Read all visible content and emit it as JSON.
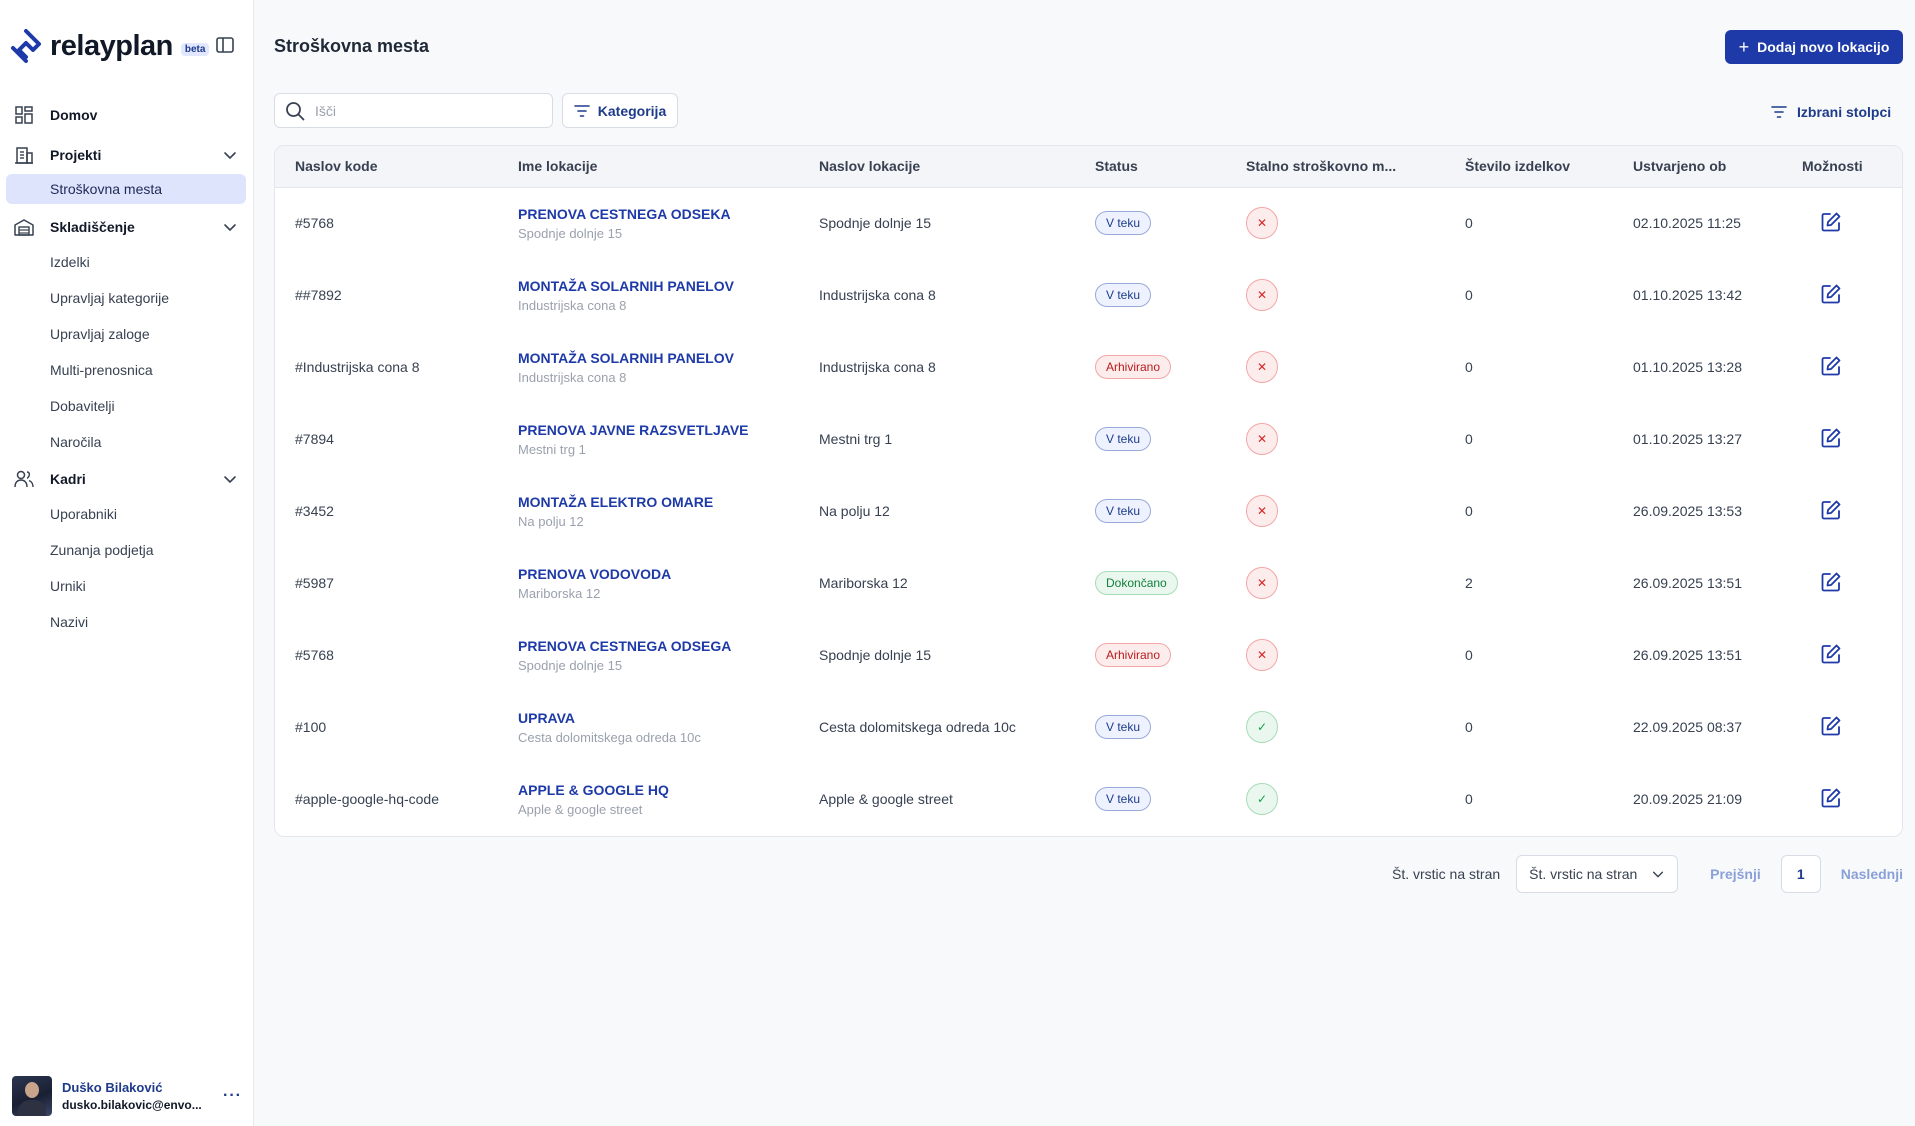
{
  "brand": {
    "name": "relayplan",
    "badge": "beta",
    "logo_icon": "relayplan-logo-icon"
  },
  "sidebar": {
    "groups": [
      {
        "label": "Domov",
        "icon": "dashboard-grid-icon",
        "expandable": false,
        "items": []
      },
      {
        "label": "Projekti",
        "icon": "building-icon",
        "expandable": true,
        "items": [
          {
            "label": "Stroškovna mesta",
            "active": true
          }
        ]
      },
      {
        "label": "Skladiščenje",
        "icon": "warehouse-icon",
        "expandable": true,
        "items": [
          {
            "label": "Izdelki"
          },
          {
            "label": "Upravljaj kategorije"
          },
          {
            "label": "Upravljaj zaloge"
          },
          {
            "label": "Multi-prenosnica"
          },
          {
            "label": "Dobavitelji"
          },
          {
            "label": "Naročila"
          }
        ]
      },
      {
        "label": "Kadri",
        "icon": "users-icon",
        "expandable": true,
        "items": [
          {
            "label": "Uporabniki"
          },
          {
            "label": "Zunanja podjetja"
          },
          {
            "label": "Urniki"
          },
          {
            "label": "Nazivi"
          }
        ]
      }
    ]
  },
  "user": {
    "name": "Duško Bilaković",
    "email": "dusko.bilakovic@envo..."
  },
  "header": {
    "title": "Stroškovna mesta",
    "add_button": "Dodaj novo lokacijo"
  },
  "toolbar": {
    "search_placeholder": "Išči",
    "category_button": "Kategorija",
    "columns_button": "Izbrani stolpci"
  },
  "table": {
    "columns": [
      "Naslov kode",
      "Ime lokacije",
      "Naslov lokacije",
      "Status",
      "Stalno stroškovno m...",
      "Število izdelkov",
      "Ustvarjeno ob",
      "Možnosti"
    ],
    "rows": [
      {
        "code": "#5768",
        "name": "PRENOVA CESTNEGA ODSEKA",
        "sub": "Spodnje dolnje 15",
        "address": "Spodnje dolnje 15",
        "status": "V teku",
        "status_color": "blue",
        "permanent": false,
        "count": "0",
        "created": "02.10.2025 11:25"
      },
      {
        "code": "##7892",
        "name": "MONTAŽA SOLARNIH PANELOV",
        "sub": "Industrijska cona 8",
        "address": "Industrijska cona 8",
        "status": "V teku",
        "status_color": "blue",
        "permanent": false,
        "count": "0",
        "created": "01.10.2025 13:42"
      },
      {
        "code": "#Industrijska cona 8",
        "name": "MONTAŽA SOLARNIH PANELOV",
        "sub": "Industrijska cona 8",
        "address": "Industrijska cona 8",
        "status": "Arhivirano",
        "status_color": "red",
        "permanent": false,
        "count": "0",
        "created": "01.10.2025 13:28"
      },
      {
        "code": "#7894",
        "name": "PRENOVA JAVNE RAZSVETLJAVE",
        "sub": "Mestni trg 1",
        "address": "Mestni trg 1",
        "status": "V teku",
        "status_color": "blue",
        "permanent": false,
        "count": "0",
        "created": "01.10.2025 13:27"
      },
      {
        "code": "#3452",
        "name": "MONTAŽA ELEKTRO OMARE",
        "sub": "Na polju 12",
        "address": "Na polju 12",
        "status": "V teku",
        "status_color": "blue",
        "permanent": false,
        "count": "0",
        "created": "26.09.2025 13:53"
      },
      {
        "code": "#5987",
        "name": "PRENOVA VODOVODA",
        "sub": "Mariborska 12",
        "address": "Mariborska 12",
        "status": "Dokončano",
        "status_color": "green",
        "permanent": false,
        "count": "2",
        "created": "26.09.2025 13:51"
      },
      {
        "code": "#5768",
        "name": "PRENOVA CESTNEGA ODSEGA",
        "sub": "Spodnje dolnje 15",
        "address": "Spodnje dolnje 15",
        "status": "Arhivirano",
        "status_color": "red",
        "permanent": false,
        "count": "0",
        "created": "26.09.2025 13:51"
      },
      {
        "code": "#100",
        "name": "UPRAVA",
        "sub": "Cesta dolomitskega odreda 10c",
        "address": "Cesta dolomitskega odreda 10c",
        "status": "V teku",
        "status_color": "blue",
        "permanent": true,
        "count": "0",
        "created": "22.09.2025 08:37"
      },
      {
        "code": "#apple-google-hq-code",
        "name": "APPLE & GOOGLE HQ",
        "sub": "Apple & google street",
        "address": "Apple & google street",
        "status": "V teku",
        "status_color": "blue",
        "permanent": true,
        "count": "0",
        "created": "20.09.2025 21:09"
      }
    ]
  },
  "pagination": {
    "rows_label": "Št. vrstic na stran",
    "rows_select": "Št. vrstic na stran",
    "prev": "Prejšnji",
    "page": "1",
    "next": "Naslednji"
  },
  "colors": {
    "primary": "#1e3aa8",
    "active_nav": "#dde4fb",
    "status_blue": "#1e3a8a",
    "status_red": "#b91c1c",
    "status_green": "#15803d"
  }
}
